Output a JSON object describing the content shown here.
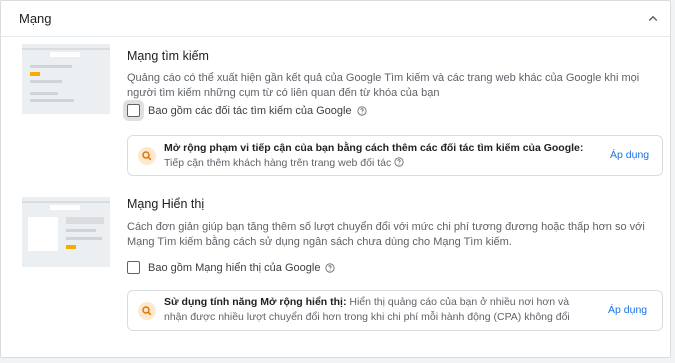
{
  "panel": {
    "title": "Mạng",
    "collapse_icon": "chevron-up-icon"
  },
  "search_network": {
    "title": "Mạng tìm kiếm",
    "description": "Quảng cáo có thể xuất hiện gần kết quả của Google Tìm kiếm và các trang web khác của Google khi mọi người tìm kiếm những cụm từ có liên quan đến từ khóa của bạn",
    "checkbox_label": "Bao gồm các đối tác tìm kiếm của Google",
    "checkbox_checked": false,
    "recommendation": {
      "bold": "Mở rộng phạm vi tiếp cận của bạn bằng cách thêm các đối tác tìm kiếm của Google:",
      "text": " Tiếp cận thêm khách hàng trên trang web đối tác",
      "apply_label": "Áp dụng"
    }
  },
  "display_network": {
    "title": "Mạng Hiển thị",
    "description": "Cách đơn giản giúp bạn tăng thêm số lượt chuyển đổi với mức chi phí tương đương hoặc thấp hơn so với Mạng Tìm kiếm bằng cách sử dụng ngân sách chưa dùng cho Mạng Tìm kiếm.",
    "checkbox_label": "Bao gồm Mạng hiển thị của Google",
    "checkbox_checked": false,
    "recommendation": {
      "bold": "Sử dụng tính năng Mở rộng hiển thị:",
      "text": " Hiển thị quảng cáo của bạn ở nhiều nơi hơn và nhận được nhiều lượt chuyển đổi hơn trong khi chi phí mỗi hành động (CPA) không đổi",
      "apply_label": "Áp dụng"
    }
  },
  "colors": {
    "accent": "#1a73e8",
    "highlight": "#f9ab00",
    "rec_icon_bg": "#fde9cf"
  }
}
